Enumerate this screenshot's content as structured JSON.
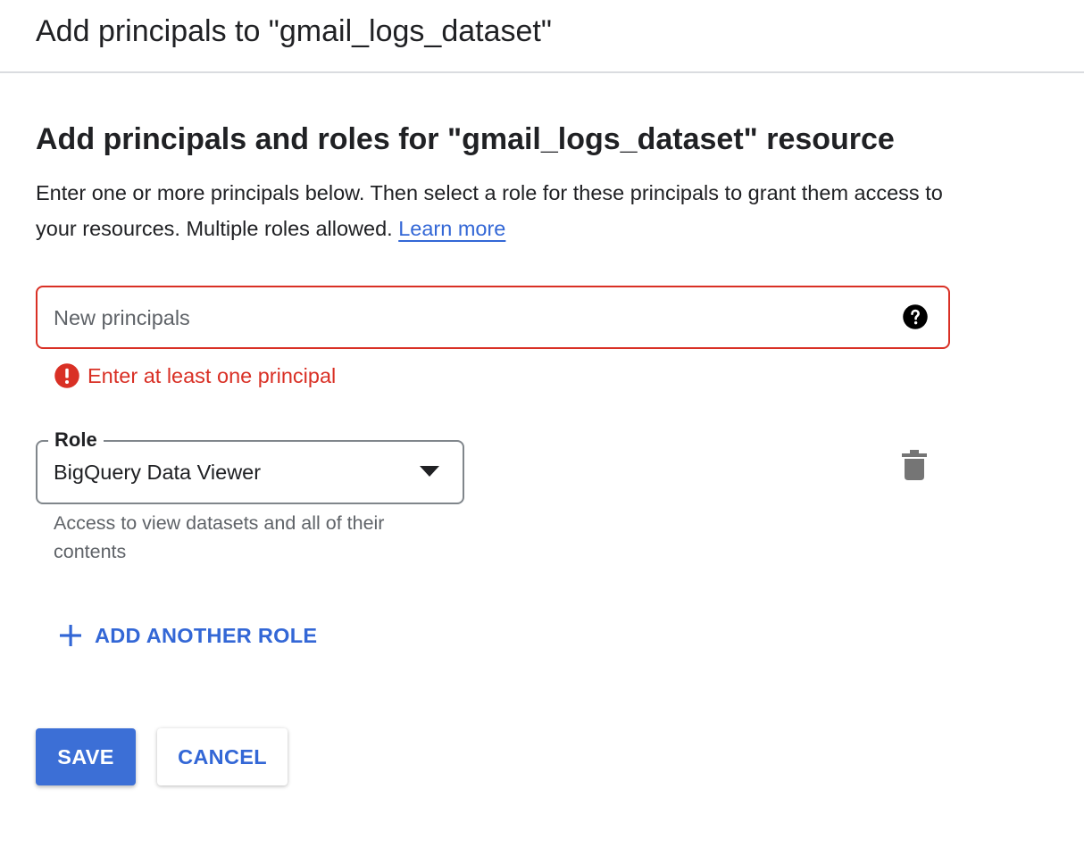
{
  "dialog": {
    "title": "Add principals to \"gmail_logs_dataset\""
  },
  "section": {
    "title": "Add principals and roles for \"gmail_logs_dataset\" resource",
    "description": "Enter one or more principals below. Then select a role for these principals to grant them access to your resources. Multiple roles allowed. ",
    "learn_more": "Learn more"
  },
  "principals": {
    "placeholder": "New principals",
    "value": "",
    "help_icon": "help-circle-icon",
    "error": "Enter at least one principal",
    "error_icon": "error-icon"
  },
  "role": {
    "label": "Role",
    "selected": "BigQuery Data Viewer",
    "helper": "Access to view datasets and all of their contents",
    "dropdown_icon": "arrow-drop-down-icon",
    "delete_icon": "trash-icon"
  },
  "actions": {
    "add_role": "ADD ANOTHER ROLE",
    "add_icon": "plus-icon",
    "save": "SAVE",
    "cancel": "CANCEL"
  },
  "colors": {
    "accent": "#3367d6",
    "primary_button": "#3c6fd6",
    "error": "#d93025",
    "text": "#202124",
    "secondary_text": "#5f6368",
    "divider": "#dadce0"
  }
}
